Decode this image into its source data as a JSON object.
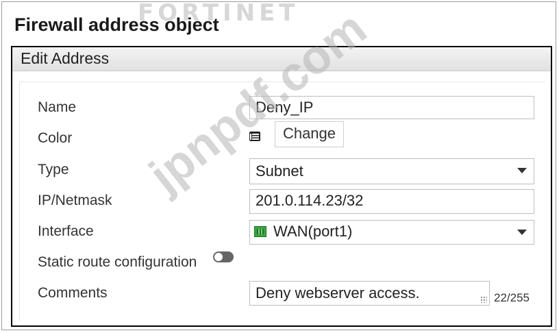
{
  "brand": {
    "logo_text": "FORTINET"
  },
  "page": {
    "title": "Firewall address object"
  },
  "panel": {
    "title": "Edit Address"
  },
  "form": {
    "name": {
      "label": "Name",
      "value": "Deny_IP"
    },
    "color": {
      "label": "Color",
      "button": "Change",
      "icon": "color-swatch-icon"
    },
    "type": {
      "label": "Type",
      "value": "Subnet"
    },
    "ip_netmask": {
      "label": "IP/Netmask",
      "value": "201.0.114.23/32"
    },
    "interface": {
      "label": "Interface",
      "value": "WAN(port1)",
      "icon": "port-icon"
    },
    "static_route": {
      "label": "Static route configuration",
      "enabled": false
    },
    "comments": {
      "label": "Comments",
      "value": "Deny webserver access.",
      "counter": "22/255"
    }
  },
  "watermark": {
    "text": "jpnpdf.com"
  }
}
